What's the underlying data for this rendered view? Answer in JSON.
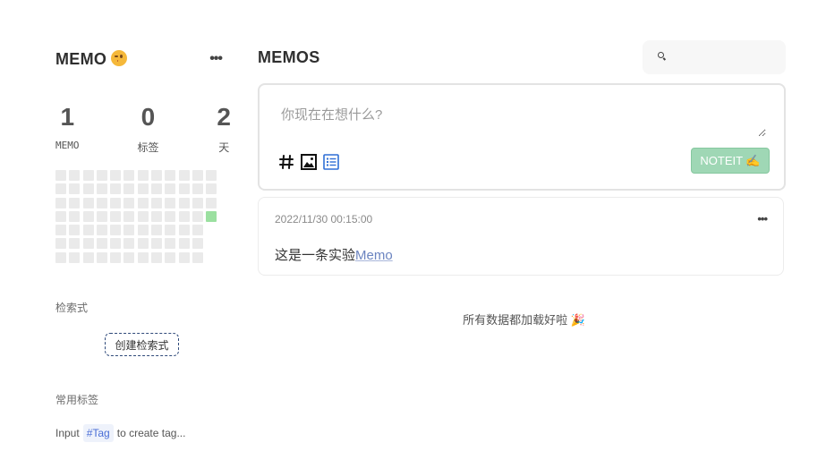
{
  "sidebar": {
    "user_name": "MEMO",
    "user_emoji": "winking-face-emoji",
    "more_label": "•••",
    "stats": [
      {
        "value": "1",
        "label": "MEMO"
      },
      {
        "value": "0",
        "label": "标签"
      },
      {
        "value": "2",
        "label": "天"
      }
    ],
    "heatmap": {
      "columns": 12,
      "rows": 7,
      "active_cells": [
        [
          11,
          3
        ]
      ],
      "filled_last_column_rows": 4,
      "colors": {
        "empty": "#eaeaea",
        "active": "#9be0a0"
      }
    },
    "query_section_title": "检索式",
    "create_query_label": "创建检索式",
    "tags_section_title": "常用标签",
    "tag_hint_prefix": "Input",
    "tag_hint_tag": "#Tag",
    "tag_hint_suffix": "to create tag..."
  },
  "main": {
    "title": "MEMOS",
    "search": {
      "placeholder": "",
      "icon": "search-icon"
    },
    "editor": {
      "placeholder": "你现在在想什么?",
      "tools": [
        "hash-icon",
        "image-icon",
        "list-icon"
      ],
      "submit_label": "NOTEIT ✍️",
      "submit_color": "#9fd7b5"
    },
    "memos": [
      {
        "time": "2022/11/30 00:15:00",
        "text": "这是一条实验",
        "link_text": "Memo",
        "more_label": "•••"
      }
    ],
    "footer": "所有数据都加载好啦 🎉"
  }
}
